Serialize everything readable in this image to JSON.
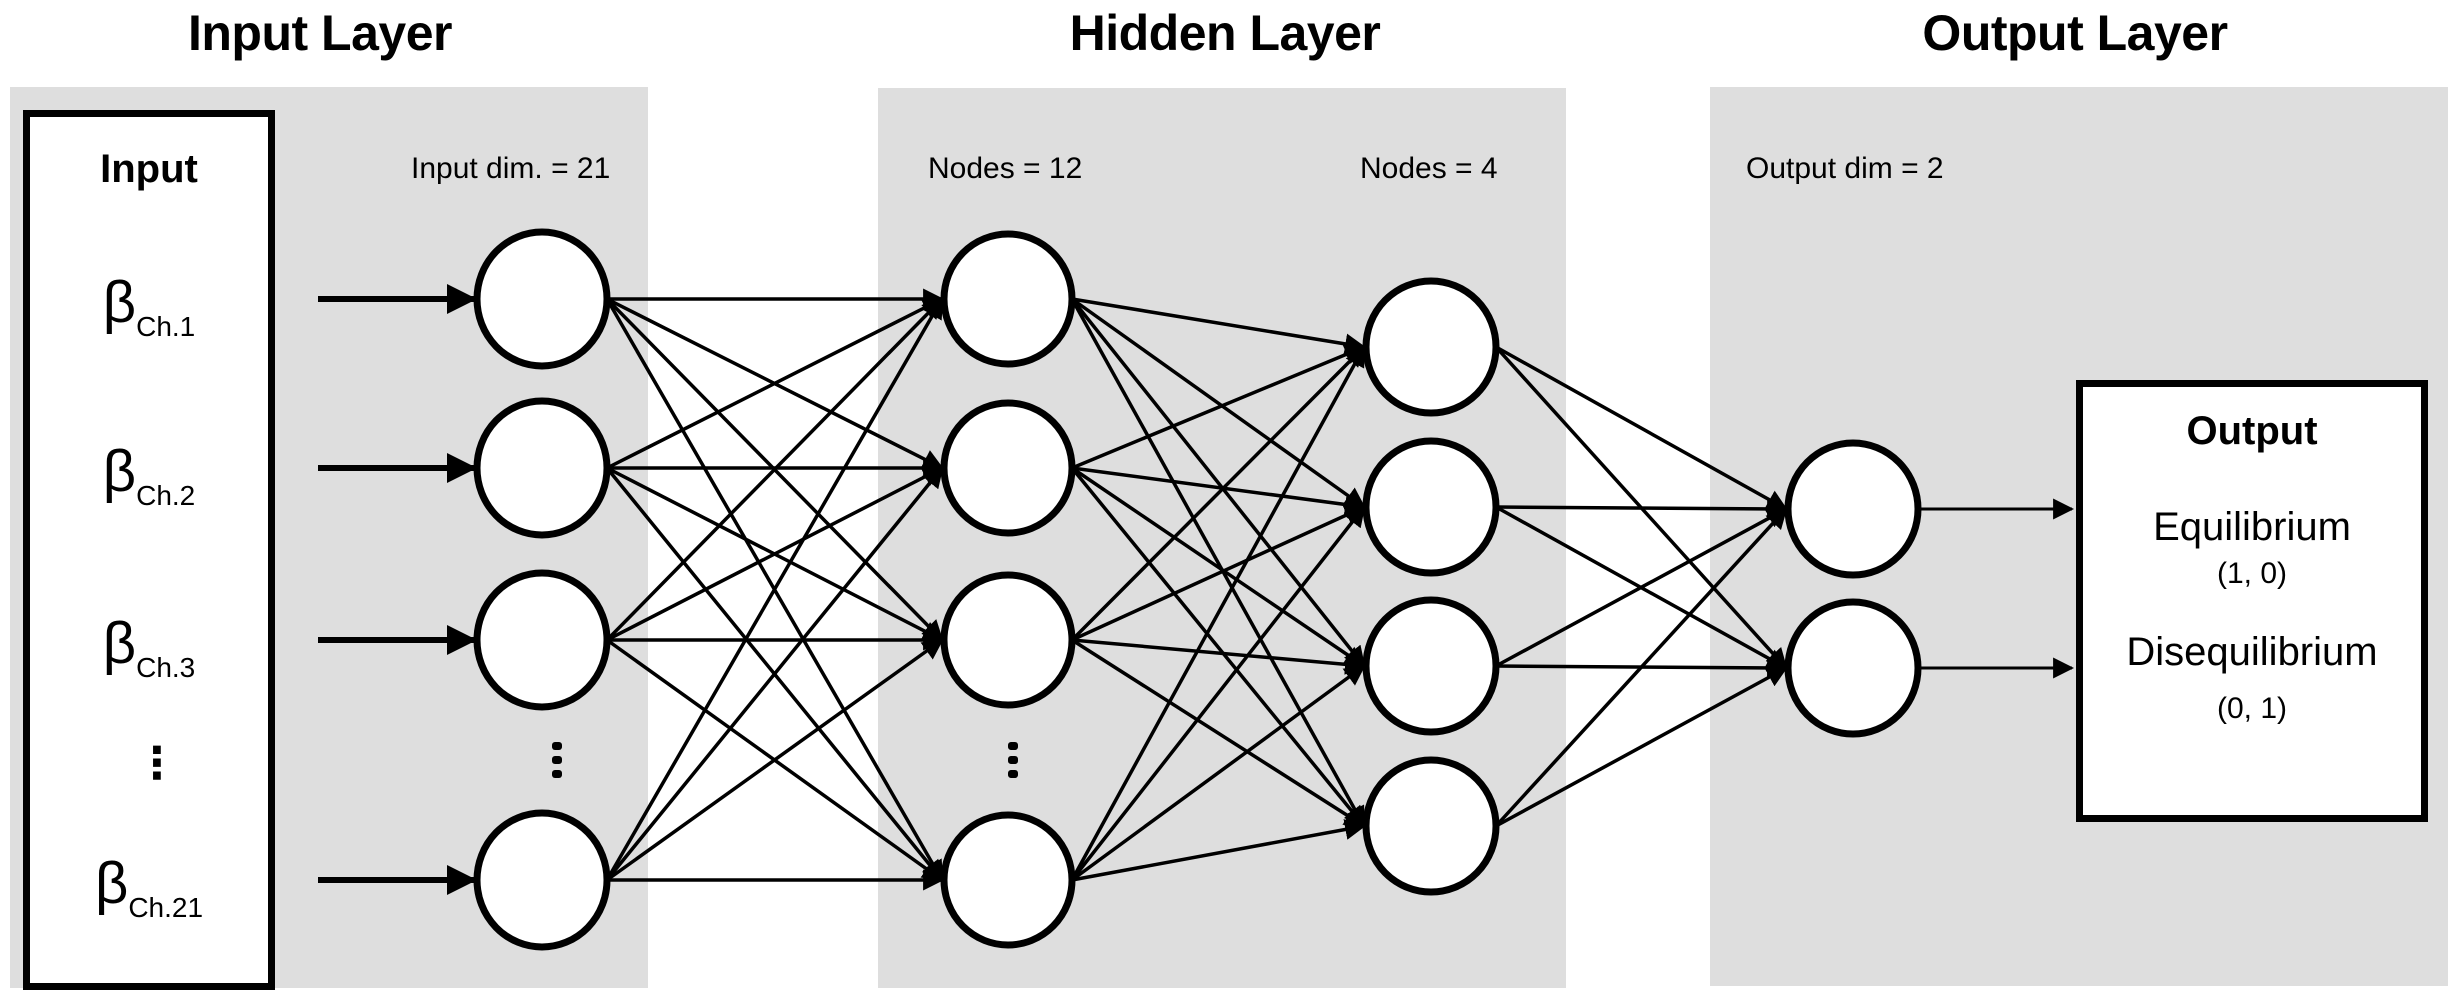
{
  "titles": {
    "input_layer": "Input Layer",
    "hidden_layer": "Hidden Layer",
    "output_layer": "Output Layer"
  },
  "labels": {
    "input_dim": "Input dim. = 21",
    "hidden1_nodes": "Nodes = 12",
    "hidden2_nodes": "Nodes = 4",
    "output_dim": "Output dim = 2"
  },
  "input_box": {
    "title": "Input",
    "symbol": "β",
    "items": [
      "Ch.1",
      "Ch.2",
      "Ch.3",
      "Ch.21"
    ],
    "ellipsis": "⋮"
  },
  "output_box": {
    "title": "Output",
    "classes": [
      {
        "name": "Equilibrium",
        "code": "(1, 0)"
      },
      {
        "name": "Disequilibrium",
        "code": "(0, 1)"
      }
    ]
  },
  "network": {
    "input_dim": 21,
    "hidden1_nodes": 12,
    "hidden2_nodes": 4,
    "output_dim": 2,
    "drawn_nodes": {
      "input": 4,
      "hidden1": 4,
      "hidden2": 4,
      "output": 2
    },
    "ellipsis": "⋮"
  },
  "colors": {
    "panel": "#dedede",
    "stroke": "#000000",
    "node_fill": "#ffffff"
  }
}
